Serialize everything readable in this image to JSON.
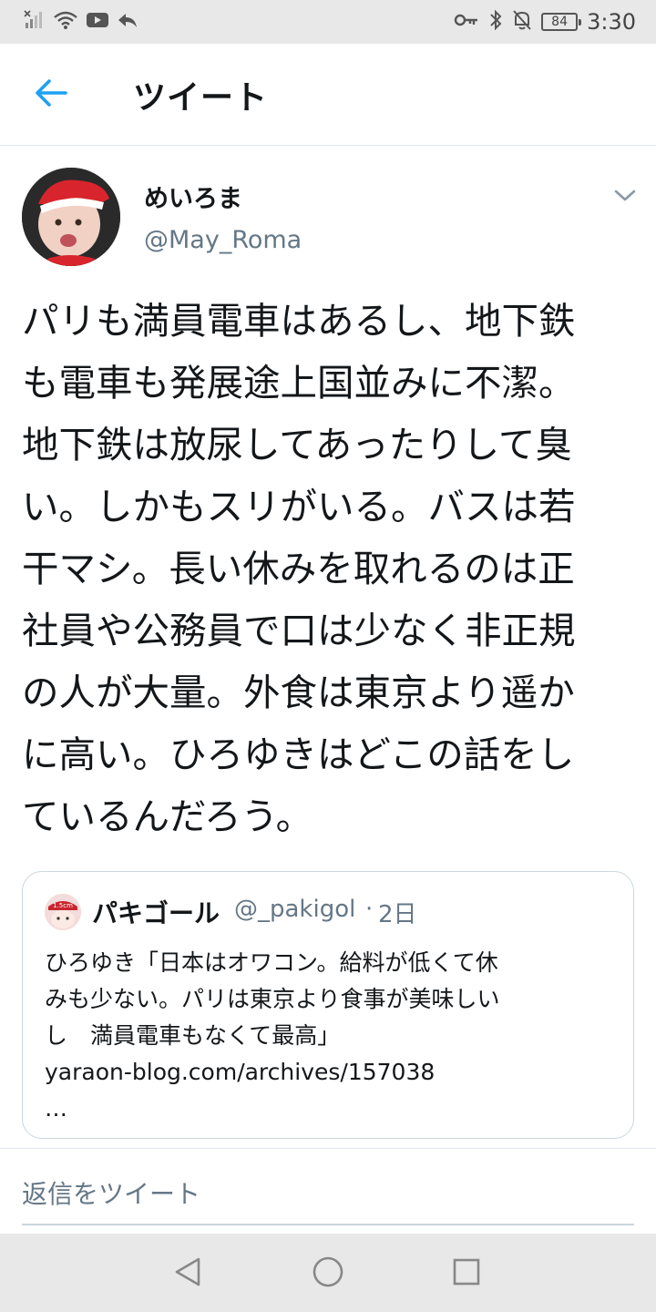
{
  "status_bar": {
    "time": "3:30",
    "battery": "84"
  },
  "header": {
    "title": "ツイート"
  },
  "tweet": {
    "display_name": "めいろま",
    "handle": "@May_Roma",
    "text": "パリも満員電車はあるし、地下鉄\nも電車も発展途上国並みに不潔。\n地下鉄は放尿してあったりして臭\nい。しかもスリがいる。バスは若\n干マシ。長い休みを取れるのは正\n社員や公務員で口は少なく非正規\nの人が大量。外食は東京より遥か\nに高い。ひろゆきはどこの話をし\nているんだろう。"
  },
  "quoted_tweet": {
    "display_name": "パキゴール",
    "avatar_label": "1.5cm",
    "handle": "@_pakigol",
    "separator": "·",
    "date": "2日",
    "text": "ひろゆき「日本はオワコン。給料が低くて休\nみも少ない。パリは東京より食事が美味しい\nし　満員電車もなくて最高」\nyaraon-blog.com/archives/157038\n…"
  },
  "reply": {
    "placeholder": "返信をツイート"
  },
  "colors": {
    "accent": "#1da1f2",
    "secondary_text": "#657786",
    "border": "#ccd6dd"
  }
}
